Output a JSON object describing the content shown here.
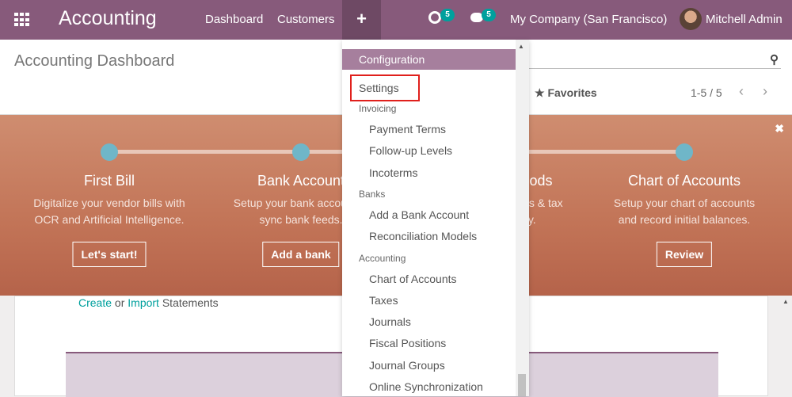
{
  "navbar": {
    "app_title": "Accounting",
    "menu": [
      "Dashboard",
      "Customers"
    ],
    "plus_icon": "plus-icon",
    "activity_count": "5",
    "message_count": "5",
    "company": "My Company (San Francisco)",
    "user": "Mitchell Admin"
  },
  "control_panel": {
    "title": "Accounting Dashboard",
    "favorites": "Favorites",
    "pager": "1-5 / 5"
  },
  "onboarding": {
    "steps": [
      {
        "title": "First Bill",
        "description": "Digitalize your vendor bills with OCR and Artificial Intelligence.",
        "button": "Let's start!"
      },
      {
        "title": "Bank Account",
        "description": "Setup your bank account to sync bank feeds.",
        "button": "Add a bank"
      },
      {
        "title": "Accounting Periods",
        "description": "Define your fiscal years & tax returns periodicity.",
        "button": ""
      },
      {
        "title": "Chart of Accounts",
        "description": "Setup your chart of accounts and record initial balances.",
        "button": "Review"
      }
    ],
    "step_color": "#6fb6c8"
  },
  "journal_card": {
    "create": "Create",
    "or": "or",
    "import": "Import",
    "statements": "Statements"
  },
  "dropdown": {
    "header": "Configuration",
    "settings": "Settings",
    "sections": [
      {
        "label": "Invoicing",
        "items": [
          "Payment Terms",
          "Follow-up Levels",
          "Incoterms"
        ]
      },
      {
        "label": "Banks",
        "items": [
          "Add a Bank Account",
          "Reconciliation Models"
        ]
      },
      {
        "label": "Accounting",
        "items": [
          "Chart of Accounts",
          "Taxes",
          "Journals",
          "Fiscal Positions",
          "Journal Groups",
          "Online Synchronization"
        ]
      }
    ]
  },
  "colors": {
    "brand": "#875a7b",
    "accent": "#00a09d",
    "highlight": "#e0201c"
  }
}
